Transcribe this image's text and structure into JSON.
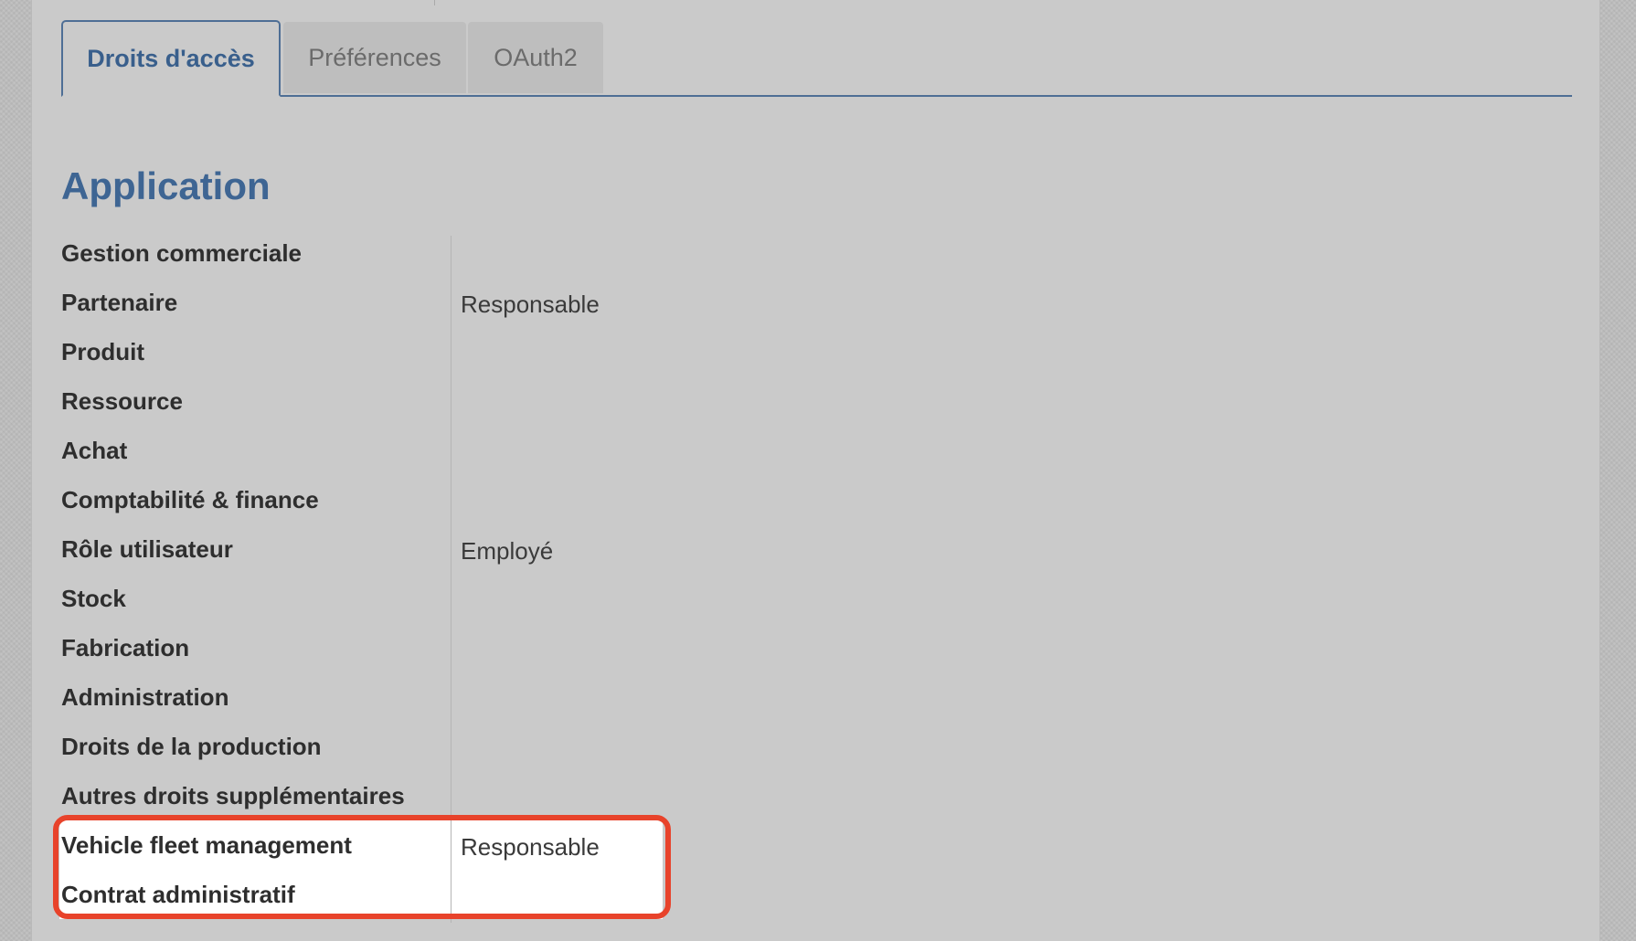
{
  "tabs": [
    {
      "label": "Droits d'accès",
      "active": true
    },
    {
      "label": "Préférences",
      "active": false
    },
    {
      "label": "OAuth2",
      "active": false
    }
  ],
  "section": {
    "title": "Application"
  },
  "rows": [
    {
      "label": "Gestion commerciale",
      "value": ""
    },
    {
      "label": "Partenaire",
      "value": "Responsable"
    },
    {
      "label": "Produit",
      "value": ""
    },
    {
      "label": "Ressource",
      "value": ""
    },
    {
      "label": "Achat",
      "value": ""
    },
    {
      "label": "Comptabilité & finance",
      "value": ""
    },
    {
      "label": "Rôle utilisateur",
      "value": "Employé"
    },
    {
      "label": "Stock",
      "value": ""
    },
    {
      "label": "Fabrication",
      "value": ""
    },
    {
      "label": "Administration",
      "value": ""
    },
    {
      "label": "Droits de la production",
      "value": ""
    },
    {
      "label": "Autres droits supplémentaires",
      "value": ""
    },
    {
      "label": "Vehicle fleet management",
      "value": "Responsable"
    },
    {
      "label": "Contrat administratif",
      "value": ""
    }
  ],
  "colors": {
    "accent": "#3e6593",
    "highlight_outline": "#e8432b",
    "page_background": "#cacaca"
  }
}
